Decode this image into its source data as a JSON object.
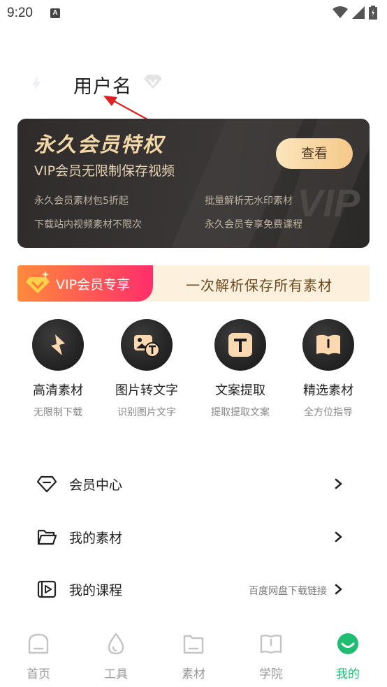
{
  "status_bar": {
    "time": "9:20",
    "notification_icon": "a-notification-icon",
    "icons": [
      "wifi-icon",
      "signal-icon",
      "battery-icon"
    ]
  },
  "profile": {
    "username": "用户名",
    "avatar_icon": "avatar-icon",
    "badge_icon": "vip-diamond-icon"
  },
  "vip_card": {
    "title": "永久会员特权",
    "subtitle": "VIP会员无限制保存视频",
    "button_label": "查看",
    "perks": [
      "永久会员素材包5折起",
      "批量解析无水印素材",
      "下载站内视频素材不限次",
      "永久会员专享免费课程"
    ]
  },
  "vip_banner": {
    "tag": "VIP会员专享",
    "text": "一次解析保存所有素材"
  },
  "tools": [
    {
      "title": "高清素材",
      "desc": "无限制下载",
      "icon": "lightning-icon"
    },
    {
      "title": "图片转文字",
      "desc": "识别图片文字",
      "icon": "image-to-text-icon"
    },
    {
      "title": "文案提取",
      "desc": "提取提取文案",
      "icon": "text-t-icon"
    },
    {
      "title": "精选素材",
      "desc": "全方位指导",
      "icon": "book-icon"
    }
  ],
  "menu": [
    {
      "label": "会员中心",
      "icon": "diamond-icon",
      "extra": ""
    },
    {
      "label": "我的素材",
      "icon": "folder-icon",
      "extra": ""
    },
    {
      "label": "我的课程",
      "icon": "video-play-icon",
      "extra": "百度网盘下载链接"
    }
  ],
  "bottom_nav": [
    {
      "label": "首页",
      "icon": "home-icon",
      "active": false
    },
    {
      "label": "工具",
      "icon": "drop-icon",
      "active": false
    },
    {
      "label": "素材",
      "icon": "folder-icon",
      "active": false
    },
    {
      "label": "学院",
      "icon": "book-icon",
      "active": false
    },
    {
      "label": "我的",
      "icon": "profile-smile-icon",
      "active": true
    }
  ],
  "colors": {
    "accent_green": "#1fbd71",
    "vip_gold": "#f4d9a8",
    "banner_bg": "#fdf0dc",
    "card_dark": "#2e2b2a"
  }
}
